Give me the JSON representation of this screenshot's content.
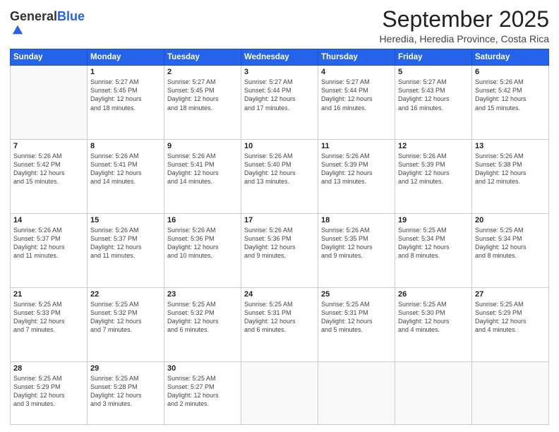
{
  "header": {
    "logo_general": "General",
    "logo_blue": "Blue",
    "month_title": "September 2025",
    "location": "Heredia, Heredia Province, Costa Rica"
  },
  "weekdays": [
    "Sunday",
    "Monday",
    "Tuesday",
    "Wednesday",
    "Thursday",
    "Friday",
    "Saturday"
  ],
  "weeks": [
    [
      {
        "day": "",
        "info": ""
      },
      {
        "day": "1",
        "info": "Sunrise: 5:27 AM\nSunset: 5:45 PM\nDaylight: 12 hours\nand 18 minutes."
      },
      {
        "day": "2",
        "info": "Sunrise: 5:27 AM\nSunset: 5:45 PM\nDaylight: 12 hours\nand 18 minutes."
      },
      {
        "day": "3",
        "info": "Sunrise: 5:27 AM\nSunset: 5:44 PM\nDaylight: 12 hours\nand 17 minutes."
      },
      {
        "day": "4",
        "info": "Sunrise: 5:27 AM\nSunset: 5:44 PM\nDaylight: 12 hours\nand 16 minutes."
      },
      {
        "day": "5",
        "info": "Sunrise: 5:27 AM\nSunset: 5:43 PM\nDaylight: 12 hours\nand 16 minutes."
      },
      {
        "day": "6",
        "info": "Sunrise: 5:26 AM\nSunset: 5:42 PM\nDaylight: 12 hours\nand 15 minutes."
      }
    ],
    [
      {
        "day": "7",
        "info": "Sunrise: 5:26 AM\nSunset: 5:42 PM\nDaylight: 12 hours\nand 15 minutes."
      },
      {
        "day": "8",
        "info": "Sunrise: 5:26 AM\nSunset: 5:41 PM\nDaylight: 12 hours\nand 14 minutes."
      },
      {
        "day": "9",
        "info": "Sunrise: 5:26 AM\nSunset: 5:41 PM\nDaylight: 12 hours\nand 14 minutes."
      },
      {
        "day": "10",
        "info": "Sunrise: 5:26 AM\nSunset: 5:40 PM\nDaylight: 12 hours\nand 13 minutes."
      },
      {
        "day": "11",
        "info": "Sunrise: 5:26 AM\nSunset: 5:39 PM\nDaylight: 12 hours\nand 13 minutes."
      },
      {
        "day": "12",
        "info": "Sunrise: 5:26 AM\nSunset: 5:39 PM\nDaylight: 12 hours\nand 12 minutes."
      },
      {
        "day": "13",
        "info": "Sunrise: 5:26 AM\nSunset: 5:38 PM\nDaylight: 12 hours\nand 12 minutes."
      }
    ],
    [
      {
        "day": "14",
        "info": "Sunrise: 5:26 AM\nSunset: 5:37 PM\nDaylight: 12 hours\nand 11 minutes."
      },
      {
        "day": "15",
        "info": "Sunrise: 5:26 AM\nSunset: 5:37 PM\nDaylight: 12 hours\nand 11 minutes."
      },
      {
        "day": "16",
        "info": "Sunrise: 5:26 AM\nSunset: 5:36 PM\nDaylight: 12 hours\nand 10 minutes."
      },
      {
        "day": "17",
        "info": "Sunrise: 5:26 AM\nSunset: 5:36 PM\nDaylight: 12 hours\nand 9 minutes."
      },
      {
        "day": "18",
        "info": "Sunrise: 5:26 AM\nSunset: 5:35 PM\nDaylight: 12 hours\nand 9 minutes."
      },
      {
        "day": "19",
        "info": "Sunrise: 5:25 AM\nSunset: 5:34 PM\nDaylight: 12 hours\nand 8 minutes."
      },
      {
        "day": "20",
        "info": "Sunrise: 5:25 AM\nSunset: 5:34 PM\nDaylight: 12 hours\nand 8 minutes."
      }
    ],
    [
      {
        "day": "21",
        "info": "Sunrise: 5:25 AM\nSunset: 5:33 PM\nDaylight: 12 hours\nand 7 minutes."
      },
      {
        "day": "22",
        "info": "Sunrise: 5:25 AM\nSunset: 5:32 PM\nDaylight: 12 hours\nand 7 minutes."
      },
      {
        "day": "23",
        "info": "Sunrise: 5:25 AM\nSunset: 5:32 PM\nDaylight: 12 hours\nand 6 minutes."
      },
      {
        "day": "24",
        "info": "Sunrise: 5:25 AM\nSunset: 5:31 PM\nDaylight: 12 hours\nand 6 minutes."
      },
      {
        "day": "25",
        "info": "Sunrise: 5:25 AM\nSunset: 5:31 PM\nDaylight: 12 hours\nand 5 minutes."
      },
      {
        "day": "26",
        "info": "Sunrise: 5:25 AM\nSunset: 5:30 PM\nDaylight: 12 hours\nand 4 minutes."
      },
      {
        "day": "27",
        "info": "Sunrise: 5:25 AM\nSunset: 5:29 PM\nDaylight: 12 hours\nand 4 minutes."
      }
    ],
    [
      {
        "day": "28",
        "info": "Sunrise: 5:25 AM\nSunset: 5:29 PM\nDaylight: 12 hours\nand 3 minutes."
      },
      {
        "day": "29",
        "info": "Sunrise: 5:25 AM\nSunset: 5:28 PM\nDaylight: 12 hours\nand 3 minutes."
      },
      {
        "day": "30",
        "info": "Sunrise: 5:25 AM\nSunset: 5:27 PM\nDaylight: 12 hours\nand 2 minutes."
      },
      {
        "day": "",
        "info": ""
      },
      {
        "day": "",
        "info": ""
      },
      {
        "day": "",
        "info": ""
      },
      {
        "day": "",
        "info": ""
      }
    ]
  ]
}
